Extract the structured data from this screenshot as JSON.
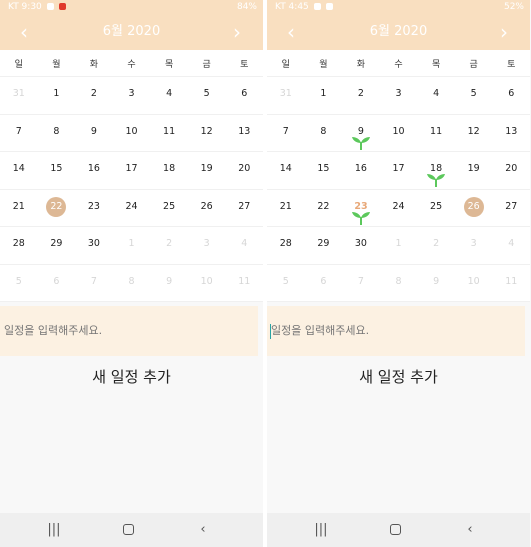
{
  "left": {
    "status": {
      "carrier_time": "KT 9:30",
      "right": "84%"
    },
    "header": {
      "title": "6월 2020",
      "prev": "‹",
      "next": "›"
    },
    "weekdays": [
      "일",
      "월",
      "화",
      "수",
      "목",
      "금",
      "토"
    ],
    "weeks": [
      [
        {
          "d": "31",
          "other": true
        },
        {
          "d": "1"
        },
        {
          "d": "2"
        },
        {
          "d": "3"
        },
        {
          "d": "4"
        },
        {
          "d": "5"
        },
        {
          "d": "6"
        }
      ],
      [
        {
          "d": "7"
        },
        {
          "d": "8"
        },
        {
          "d": "9"
        },
        {
          "d": "10"
        },
        {
          "d": "11"
        },
        {
          "d": "12"
        },
        {
          "d": "13"
        }
      ],
      [
        {
          "d": "14"
        },
        {
          "d": "15"
        },
        {
          "d": "16"
        },
        {
          "d": "17"
        },
        {
          "d": "18"
        },
        {
          "d": "19"
        },
        {
          "d": "20"
        }
      ],
      [
        {
          "d": "21"
        },
        {
          "d": "22",
          "selected": true
        },
        {
          "d": "23"
        },
        {
          "d": "24"
        },
        {
          "d": "25"
        },
        {
          "d": "26"
        },
        {
          "d": "27"
        }
      ],
      [
        {
          "d": "28"
        },
        {
          "d": "29"
        },
        {
          "d": "30"
        },
        {
          "d": "1",
          "other": true
        },
        {
          "d": "2",
          "other": true
        },
        {
          "d": "3",
          "other": true
        },
        {
          "d": "4",
          "other": true
        }
      ],
      [
        {
          "d": "5",
          "other": true
        },
        {
          "d": "6",
          "other": true
        },
        {
          "d": "7",
          "other": true
        },
        {
          "d": "8",
          "other": true
        },
        {
          "d": "9",
          "other": true
        },
        {
          "d": "10",
          "other": true
        },
        {
          "d": "11",
          "other": true
        }
      ]
    ],
    "input": {
      "placeholder": "일정을 입력해주세요.",
      "value": ""
    },
    "add_label": "새 일정 추가"
  },
  "right": {
    "status": {
      "carrier_time": "KT 4:45",
      "right": "52%"
    },
    "header": {
      "title": "6월 2020",
      "prev": "‹",
      "next": "›"
    },
    "weekdays": [
      "일",
      "월",
      "화",
      "수",
      "목",
      "금",
      "토"
    ],
    "weeks": [
      [
        {
          "d": "31",
          "other": true
        },
        {
          "d": "1"
        },
        {
          "d": "2"
        },
        {
          "d": "3"
        },
        {
          "d": "4"
        },
        {
          "d": "5"
        },
        {
          "d": "6"
        }
      ],
      [
        {
          "d": "7"
        },
        {
          "d": "8"
        },
        {
          "d": "9",
          "sprout": true
        },
        {
          "d": "10"
        },
        {
          "d": "11"
        },
        {
          "d": "12"
        },
        {
          "d": "13"
        }
      ],
      [
        {
          "d": "14"
        },
        {
          "d": "15"
        },
        {
          "d": "16"
        },
        {
          "d": "17"
        },
        {
          "d": "18",
          "sprout": true
        },
        {
          "d": "19"
        },
        {
          "d": "20"
        }
      ],
      [
        {
          "d": "21"
        },
        {
          "d": "22"
        },
        {
          "d": "23",
          "today": true,
          "sprout": true
        },
        {
          "d": "24"
        },
        {
          "d": "25"
        },
        {
          "d": "26",
          "selected": true
        },
        {
          "d": "27"
        }
      ],
      [
        {
          "d": "28"
        },
        {
          "d": "29"
        },
        {
          "d": "30"
        },
        {
          "d": "1",
          "other": true
        },
        {
          "d": "2",
          "other": true
        },
        {
          "d": "3",
          "other": true
        },
        {
          "d": "4",
          "other": true
        }
      ],
      [
        {
          "d": "5",
          "other": true
        },
        {
          "d": "6",
          "other": true
        },
        {
          "d": "7",
          "other": true
        },
        {
          "d": "8",
          "other": true
        },
        {
          "d": "9",
          "other": true
        },
        {
          "d": "10",
          "other": true
        },
        {
          "d": "11",
          "other": true
        }
      ]
    ],
    "input": {
      "placeholder": "일정을 입력해주세요.",
      "value": ""
    },
    "add_label": "새 일정 추가"
  },
  "navbar": {
    "recents": "|||",
    "back": "‹"
  },
  "colors": {
    "header_bg": "#f9dfc0",
    "selected_circle": "#ddb895",
    "input_bg": "#fcf1e2",
    "sprout": "#5cc85c",
    "today_text": "#e8a878"
  },
  "icons": {
    "sprout": "sprout-icon",
    "home": "home-icon",
    "recents": "recents-icon",
    "back": "back-icon"
  }
}
